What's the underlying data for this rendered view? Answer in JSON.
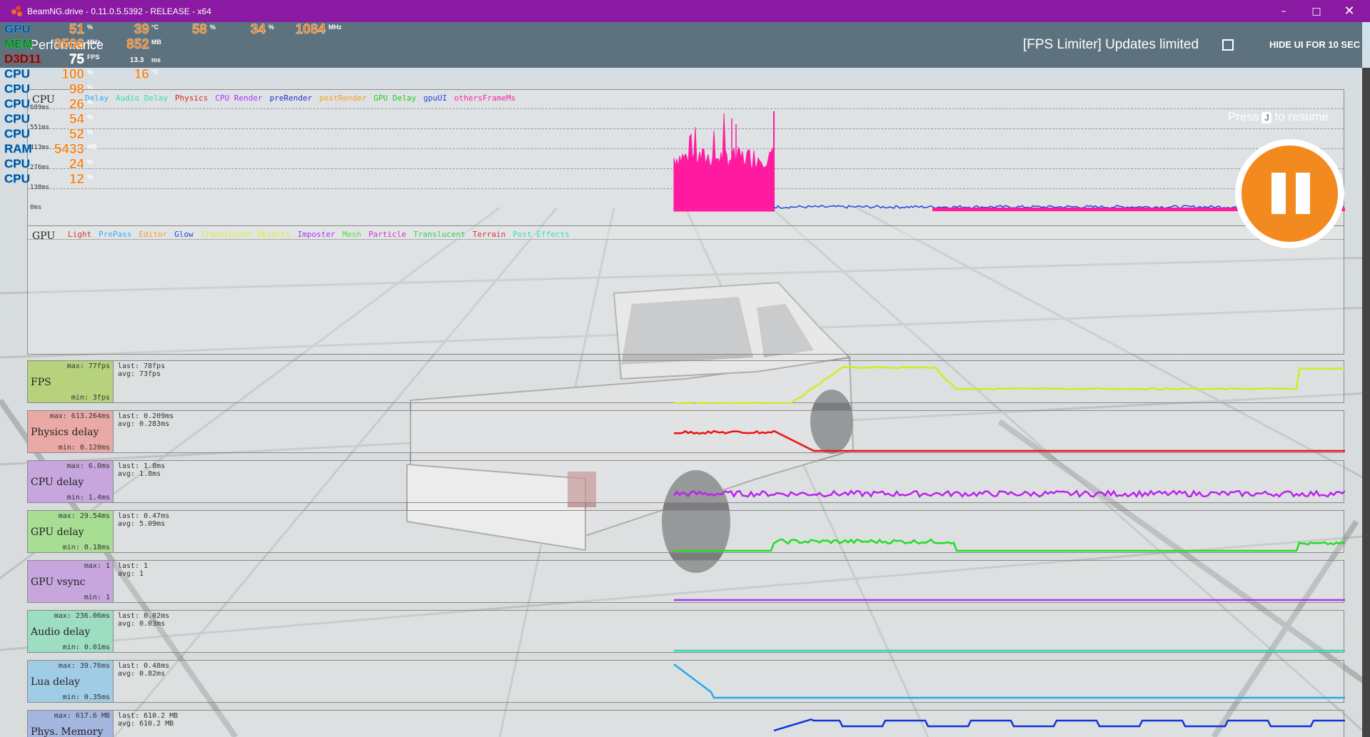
{
  "window": {
    "title": "BeamNG.drive - 0.11.0.5.5392 - RELEASE - x64"
  },
  "hud": {
    "title": "Performance",
    "fps_limiter_text": "[FPS Limiter]  Updates limited",
    "hide_ui": "HIDE UI FOR 10 SEC",
    "press": "Press",
    "key": "J",
    "to_resume": "to resume"
  },
  "stats_overlay": {
    "gpu": {
      "label": "GPU",
      "values": [
        "51",
        "39",
        "58",
        "34",
        "1084"
      ],
      "units": [
        "%",
        "°C",
        "%",
        "%",
        "MHz"
      ]
    },
    "mem": {
      "label": "MEM",
      "values": [
        "3506",
        "852"
      ],
      "units": [
        "MHz",
        "MB"
      ]
    },
    "d3d": {
      "label": "D3D11",
      "values": [
        "75",
        "13.3"
      ],
      "units": [
        "FPS",
        "ms"
      ]
    },
    "cpu_rows": [
      {
        "label": "CPU",
        "value": "100",
        "unit": "%",
        "value2": "16",
        "unit2": "°C"
      },
      {
        "label": "CPU",
        "value": "98",
        "unit": "%"
      },
      {
        "label": "CPU",
        "value": "26",
        "unit": "%"
      },
      {
        "label": "CPU",
        "value": "54",
        "unit": "%"
      },
      {
        "label": "CPU",
        "value": "52",
        "unit": "%"
      },
      {
        "label": "RAM",
        "value": "5433",
        "unit": "MB"
      },
      {
        "label": "CPU",
        "value": "24",
        "unit": "%"
      },
      {
        "label": "CPU",
        "value": "12",
        "unit": "%"
      }
    ]
  },
  "cpu_panel": {
    "title": "CPU",
    "legend": [
      {
        "name": "Delay",
        "color": "#33aaff"
      },
      {
        "name": "Audio Delay",
        "color": "#33ddbb"
      },
      {
        "name": "Physics",
        "color": "#dd2222"
      },
      {
        "name": "CPU Render",
        "color": "#aa33ff"
      },
      {
        "name": "preRender",
        "color": "#2233cc"
      },
      {
        "name": "postRender",
        "color": "#f5a020"
      },
      {
        "name": "GPU Delay",
        "color": "#22cc22"
      },
      {
        "name": "gpuUI",
        "color": "#2244dd"
      },
      {
        "name": "othersFrameMs",
        "color": "#ff22aa"
      }
    ],
    "y_labels": [
      "689ms",
      "551ms",
      "413ms",
      "276ms",
      "138ms",
      "0ms"
    ]
  },
  "gpu_panel": {
    "title": "GPU",
    "legend": [
      {
        "name": "Light",
        "color": "#dd3333"
      },
      {
        "name": "PrePass",
        "color": "#33aaff"
      },
      {
        "name": "Editor",
        "color": "#f5a020"
      },
      {
        "name": "Glow",
        "color": "#2244dd"
      },
      {
        "name": "Translucent Objects",
        "color": "#ddee22"
      },
      {
        "name": "Imposter",
        "color": "#aa33ff"
      },
      {
        "name": "Mesh",
        "color": "#55dd44"
      },
      {
        "name": "Particle",
        "color": "#cc33cc"
      },
      {
        "name": "Translucent",
        "color": "#33cc55"
      },
      {
        "name": "Terrain",
        "color": "#dd3333"
      },
      {
        "name": "Post Effects",
        "color": "#33ddbb"
      }
    ]
  },
  "metrics": [
    {
      "name": "FPS",
      "max": "max: 77fps",
      "min": "min: 3fps",
      "last": "last: 78fps",
      "avg": "avg: 73fps",
      "bg": "#b7d27c",
      "color": "#ccee22"
    },
    {
      "name": "Physics delay",
      "max": "max: 613.264ms",
      "min": "min: 0.120ms",
      "last": "last: 0.209ms",
      "avg": "avg: 0.283ms",
      "bg": "#e9a9a6",
      "color": "#ee1111"
    },
    {
      "name": "CPU delay",
      "max": "max: 6.0ms",
      "min": "min: 1.4ms",
      "last": "last: 1.8ms",
      "avg": "avg: 1.8ms",
      "bg": "#c6a6dd",
      "color": "#bb22ee"
    },
    {
      "name": "GPU delay",
      "max": "max: 29.54ms",
      "min": "min: 0.18ms",
      "last": "last: 0.47ms",
      "avg": "avg: 5.09ms",
      "bg": "#a8dd94",
      "color": "#22dd22"
    },
    {
      "name": "GPU vsync",
      "max": "max: 1",
      "min": "min: 1",
      "last": "last: 1",
      "avg": "avg: 1",
      "bg": "#c6a6dd",
      "color": "#aa33ee"
    },
    {
      "name": "Audio delay",
      "max": "max: 236.06ms",
      "min": "min: 0.01ms",
      "last": "last: 0.02ms",
      "avg": "avg: 0.03ms",
      "bg": "#9dddc2",
      "color": "#22ddaa"
    },
    {
      "name": "Lua delay",
      "max": "max: 39.76ms",
      "min": "min: 0.35ms",
      "last": "last: 0.48ms",
      "avg": "avg: 0.82ms",
      "bg": "#a0cce6",
      "color": "#22aaee"
    },
    {
      "name": "Phys. Memory",
      "max": "max: 617.6 MB",
      "min": "",
      "last": "last: 610.2 MB",
      "avg": "avg: 610.2 MB",
      "bg": "#a4b6e0",
      "color": "#1133dd"
    }
  ]
}
